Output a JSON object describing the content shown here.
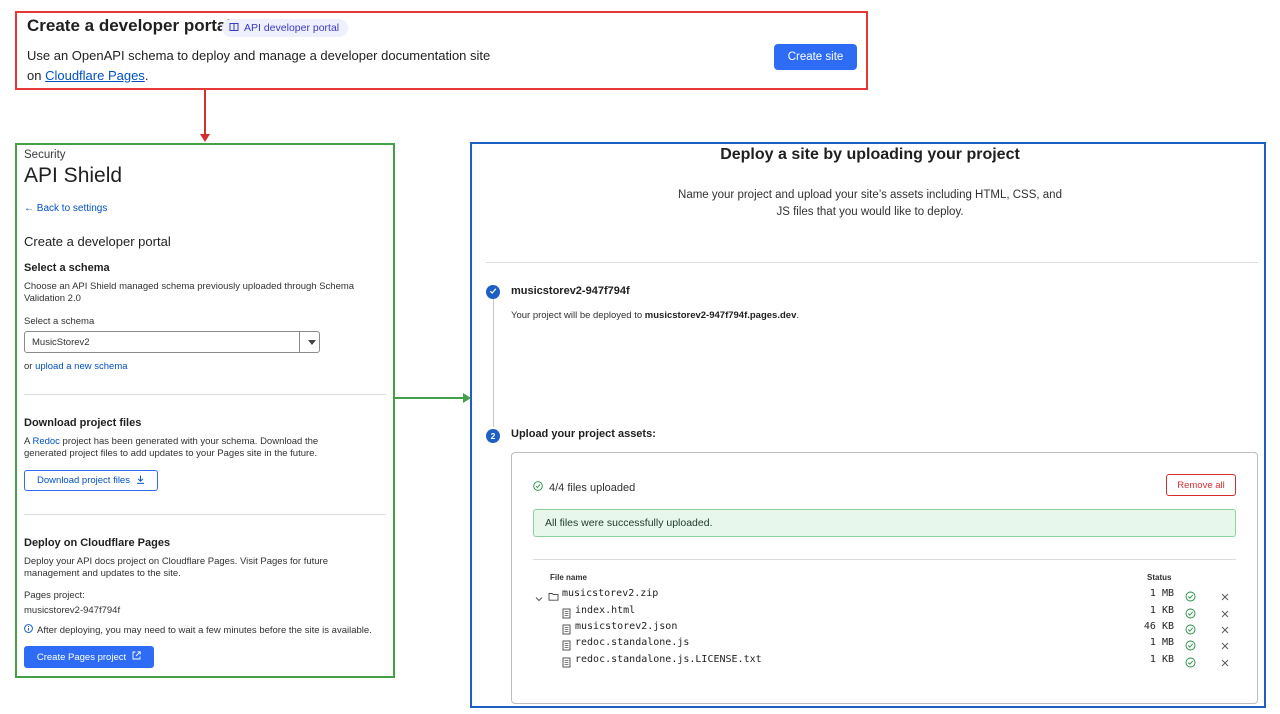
{
  "top": {
    "title": "Create a developer portal",
    "badge": "API developer portal",
    "desc_prefix": "Use an OpenAPI schema to deploy and manage a developer documentation site on ",
    "desc_link": "Cloudflare Pages",
    "desc_suffix": ".",
    "create_site_button": "Create site"
  },
  "left": {
    "section": "Security",
    "title": "API Shield",
    "back_link": "← Back to settings",
    "heading": "Create a developer portal",
    "schema_heading": "Select a schema",
    "schema_desc": "Choose an API Shield managed schema previously uploaded through Schema Validation 2.0",
    "select_label": "Select a schema",
    "select_value": "MusicStorev2",
    "or_text": "or ",
    "upload_link": "upload a new schema",
    "download_heading": "Download project files",
    "download_desc_prefix": "A ",
    "download_desc_link": "Redoc",
    "download_desc_suffix": " project has been generated with your schema. Download the generated project files to add updates to your Pages site in the future.",
    "download_button": "Download project files",
    "deploy_heading": "Deploy on Cloudflare Pages",
    "deploy_desc": "Deploy your API docs project on Cloudflare Pages. Visit Pages for future management and updates to the site.",
    "pages_label": "Pages project:",
    "pages_value": "musicstorev2-947f794f",
    "info_text": "After deploying, you may need to wait a few minutes before the site is available.",
    "create_pages_button": "Create Pages project"
  },
  "right": {
    "title": "Deploy a site by uploading your project",
    "desc": "Name your project and upload your site’s assets including HTML, CSS, and JS files that you would like to deploy.",
    "step1_title": "musicstorev2-947f794f",
    "step1_desc_prefix": "Your project will be deployed to ",
    "step1_desc_domain": "musicstorev2-947f794f.pages.dev",
    "step1_desc_suffix": ".",
    "step2_number": "2",
    "step2_title": "Upload your project assets:",
    "upload": {
      "count": "4/4 files uploaded",
      "remove_all_button": "Remove all",
      "success_message": "All files were successfully uploaded.",
      "col_name": "File name",
      "col_status": "Status",
      "files": [
        {
          "name": "musicstorev2.zip",
          "size": "1 MB",
          "type": "folder"
        },
        {
          "name": "index.html",
          "size": "1 KB",
          "type": "file"
        },
        {
          "name": "musicstorev2.json",
          "size": "46 KB",
          "type": "file"
        },
        {
          "name": "redoc.standalone.js",
          "size": "1 MB",
          "type": "file"
        },
        {
          "name": "redoc.standalone.js.LICENSE.txt",
          "size": "1 KB",
          "type": "file"
        }
      ]
    }
  },
  "colors": {
    "primary": "#2f6cf6",
    "link": "#0051c3",
    "danger": "#d32f2f",
    "success": "#1e8e3e",
    "annotation_red": "#e53935",
    "annotation_green": "#43a047",
    "annotation_blue": "#1e5fc4"
  }
}
